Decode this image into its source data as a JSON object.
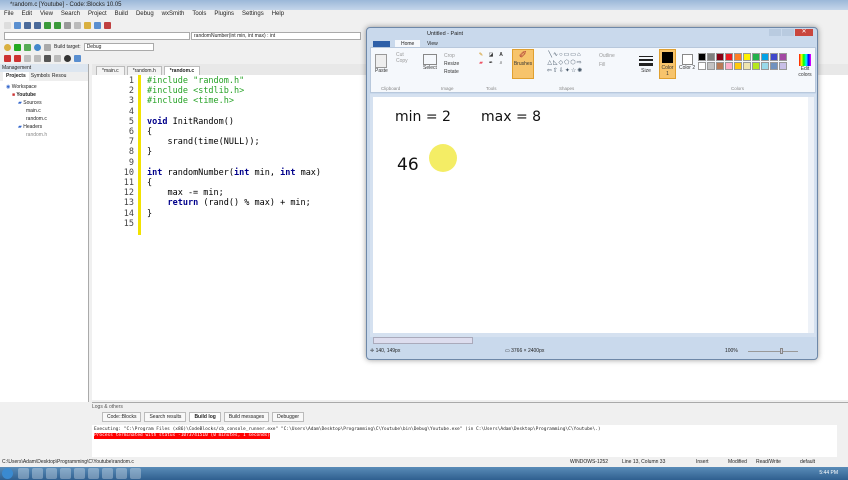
{
  "window": {
    "title": "*random.c [Youtube] - Code::Blocks 10.05"
  },
  "menu": [
    "File",
    "Edit",
    "View",
    "Search",
    "Project",
    "Build",
    "Debug",
    "wxSmith",
    "Tools",
    "Plugins",
    "Settings",
    "Help"
  ],
  "toolbar": {
    "function_combo": "randomNumber(int min, int max) : int",
    "build_target_label": "Build target:",
    "build_target": "Debug"
  },
  "management": {
    "title": "Management",
    "tabs": [
      "Projects",
      "Symbols",
      "Resou"
    ],
    "tree": [
      "Workspace",
      "Youtube",
      "Sources",
      "main.c",
      "random.c",
      "Headers",
      "random.h"
    ]
  },
  "editor": {
    "tabs": [
      "*main.c",
      "*random.h",
      "*random.c"
    ],
    "lines": [
      {
        "n": "1",
        "t": "#include \"random.h\""
      },
      {
        "n": "2",
        "t": "#include <stdlib.h>"
      },
      {
        "n": "3",
        "t": "#include <time.h>"
      },
      {
        "n": "4",
        "t": ""
      },
      {
        "n": "5",
        "t": "void InitRandom()"
      },
      {
        "n": "6",
        "t": "{"
      },
      {
        "n": "7",
        "t": "    srand(time(NULL));"
      },
      {
        "n": "8",
        "t": "}"
      },
      {
        "n": "9",
        "t": ""
      },
      {
        "n": "10",
        "t": "int randomNumber(int min, int max)"
      },
      {
        "n": "11",
        "t": "{"
      },
      {
        "n": "12",
        "t": "    max -= min;"
      },
      {
        "n": "13",
        "t": "    return (rand() % max) + min;"
      },
      {
        "n": "14",
        "t": "}"
      },
      {
        "n": "15",
        "t": ""
      }
    ]
  },
  "paint": {
    "title": "Untitled - Paint",
    "tabs": [
      "Home",
      "View"
    ],
    "clipboard": {
      "paste": "Paste",
      "cut": "Cut",
      "copy": "Copy",
      "label": "Clipboard"
    },
    "image": {
      "select": "Select",
      "crop": "Crop",
      "resize": "Resize",
      "rotate": "Rotate",
      "label": "Image"
    },
    "tools_label": "Tools",
    "brushes": "Brushes",
    "shapes_label": "Shapes",
    "outline": "Outline",
    "fill": "Fill",
    "size": "Size",
    "color1": "Color 1",
    "color2": "Color 2",
    "colors_label": "Colors",
    "edit_colors": "Edit colors",
    "palette": [
      "#000000",
      "#7f7f7f",
      "#880015",
      "#ed1c24",
      "#ff7f27",
      "#fff200",
      "#22b14c",
      "#00a2e8",
      "#3f48cc",
      "#a349a4",
      "#ffffff",
      "#c3c3c3",
      "#b97a57",
      "#ffaec9",
      "#ffc90e",
      "#efe4b0",
      "#b5e61d",
      "#99d9ea",
      "#7092be",
      "#c8bfe7"
    ],
    "drawing": {
      "min": "min = 2",
      "max": "max = 8",
      "digits": "46"
    },
    "status": {
      "cursor": "140, 149px",
      "size": "3766 × 2400px",
      "zoom": "100%"
    }
  },
  "logs": {
    "title": "Logs & others",
    "tabs": [
      "Code::Blocks",
      "Search results",
      "Build log",
      "Build messages",
      "Debugger"
    ],
    "line1": "Executing: \"C:\\Program Files (x86)\\CodeBlocks/cb_console_runner.exe\" \"C:\\Users\\Adam\\Desktop\\Programming\\C\\Youtube\\bin\\Debug\\Youtube.exe\"  (in C:\\Users\\Adam\\Desktop\\Programming\\C\\Youtube\\.)",
    "line2": "Process terminated with status -1073741510 (0 minutes, 1 seconds)"
  },
  "status": {
    "path": "C:\\Users\\Adam\\Desktop\\Programming\\C\\Youtube\\random.c",
    "encoding": "WINDOWS-1252",
    "position": "Line 13, Column 33",
    "mode": "Insert",
    "modified": "Modified",
    "rw": "Read/Write",
    "profile": "default"
  },
  "taskbar": {
    "clock": "5:44 PM"
  },
  "colors": {
    "error_bg": "#ff0000",
    "accent": "#f7c46c"
  }
}
